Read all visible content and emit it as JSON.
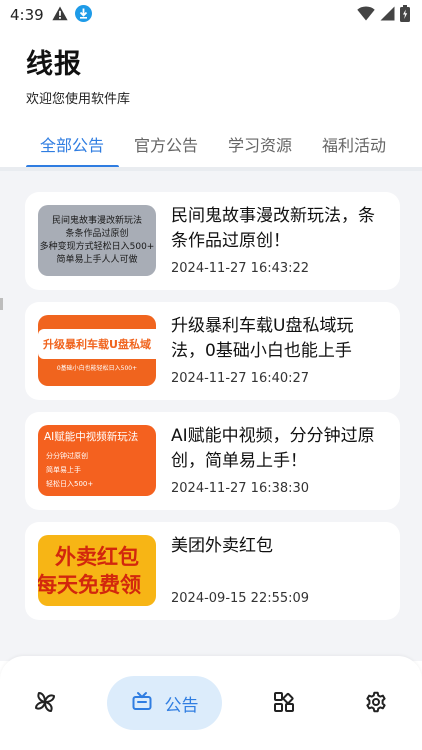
{
  "status_bar": {
    "time": "4:39",
    "left_icons": [
      "warning-icon",
      "download-icon"
    ],
    "right_icons": [
      "wifi-icon",
      "signal-icon",
      "battery-icon"
    ]
  },
  "header": {
    "title": "线报",
    "subtitle": "欢迎您使用软件库"
  },
  "tabs": [
    {
      "label": "全部公告",
      "active": true
    },
    {
      "label": "官方公告",
      "active": false
    },
    {
      "label": "学习资源",
      "active": false
    },
    {
      "label": "福利活动",
      "active": false
    }
  ],
  "colors": {
    "accent": "#2f7de1",
    "active_nav_bg": "#dcecfb",
    "content_bg": "#f3f4f7"
  },
  "announcements": [
    {
      "title": "民间鬼故事漫改新玩法，条条作品过原创！",
      "date": "2024-11-27 16:43:22",
      "thumb_lines": [
        "民间鬼故事漫改新玩法",
        "条条作品过原创",
        "多种变现方式轻松日入500+",
        "简单易上手人人可做"
      ]
    },
    {
      "title": "升级暴利车载U盘私域玩法，0基础小白也能上手",
      "date": "2024-11-27 16:40:27",
      "thumb_banner": "升级暴利车载U盘私域",
      "thumb_sub": "0基础小白也能轻松日入500+"
    },
    {
      "title": "AI赋能中视频，分分钟过原创，简单易上手！",
      "date": "2024-11-27 16:38:30",
      "thumb_heading": "AI赋能中视频新玩法",
      "thumb_lines": [
        "分分钟过原创",
        "简单易上手",
        "轻松日入500+"
      ]
    },
    {
      "title": "美团外卖红包",
      "date": "2024-09-15 22:55:09",
      "thumb_lines": [
        "外卖红包",
        "每天免费领"
      ]
    }
  ],
  "bottom_nav": [
    {
      "icon": "pinwheel-icon",
      "label": "",
      "active": false
    },
    {
      "icon": "announcement-icon",
      "label": "公告",
      "active": true
    },
    {
      "icon": "apps-grid-icon",
      "label": "",
      "active": false
    },
    {
      "icon": "settings-icon",
      "label": "",
      "active": false
    }
  ]
}
